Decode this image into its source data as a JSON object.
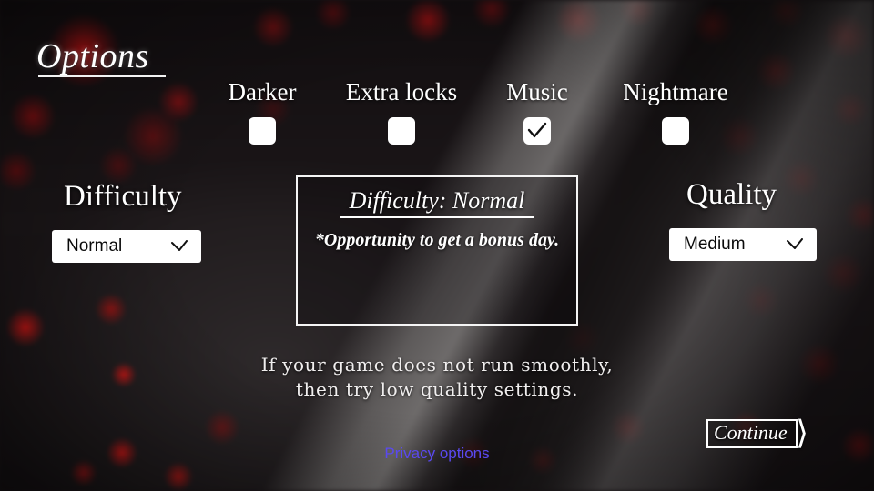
{
  "screen": {
    "title": "Options",
    "background_base_color": "#171215",
    "accent_red": "#b81112",
    "link_color": "#5a49f0"
  },
  "toggles": [
    {
      "label": "Darker",
      "checked": false,
      "icon": "checkbox-icon"
    },
    {
      "label": "Extra locks",
      "checked": false,
      "icon": "checkbox-icon"
    },
    {
      "label": "Music",
      "checked": true,
      "icon": "checkmark-icon"
    },
    {
      "label": "Nightmare",
      "checked": false,
      "icon": "checkbox-icon"
    }
  ],
  "difficulty": {
    "label": "Difficulty",
    "selected": "Normal",
    "chevron_icon": "chevron-down-icon"
  },
  "quality": {
    "label": "Quality",
    "selected": "Medium",
    "chevron_icon": "chevron-down-icon"
  },
  "info_panel": {
    "title": "Difficulty: Normal",
    "description": "*Opportunity to get a bonus day."
  },
  "hint": {
    "line1": "If your game does not run smoothly,",
    "line2": "then try low quality settings."
  },
  "privacy": {
    "label": "Privacy options"
  },
  "continue": {
    "label": "Continue",
    "chevron_icon": "chevron-right-icon"
  }
}
